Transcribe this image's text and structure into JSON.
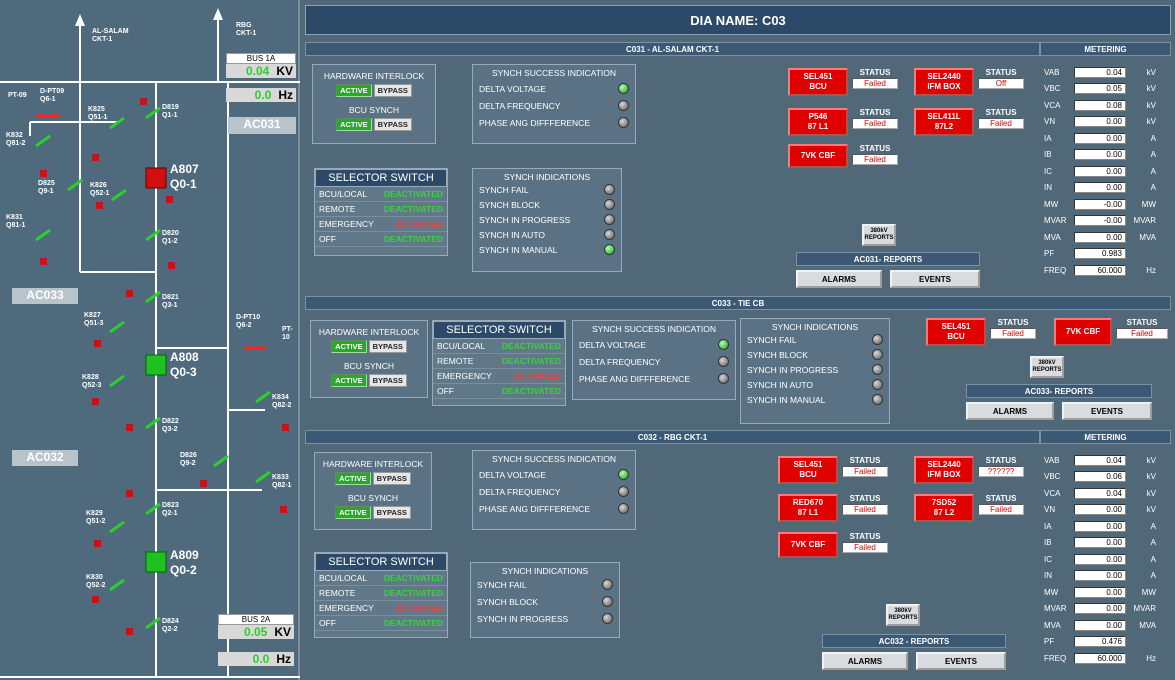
{
  "title": "DIA NAME: C03",
  "left": {
    "top_label1": "AL-SALAM",
    "top_label2": "CKT-1",
    "rbg_label1": "RBG",
    "rbg_label2": "CKT-1",
    "bus1a": "BUS 1A",
    "bus1a_kv": "0.04",
    "bus1a_kv_unit": "KV",
    "bus1a_hz": "0.0",
    "bus1a_hz_unit": "Hz",
    "ac031": "AC031",
    "ac033": "AC033",
    "ac032": "AC032",
    "bus2a": "BUS 2A",
    "bus2a_kv": "0.05",
    "bus2a_kv_unit": "KV",
    "bus2a_hz": "0.0",
    "bus2a_hz_unit": "Hz",
    "a807": "A807",
    "q01": "Q0-1",
    "a808": "A808",
    "q03": "Q0-3",
    "a809": "A809",
    "q02": "Q0-2",
    "pt09": "PT-09",
    "dpt09a": "D-PT09",
    "dpt09b": "Q6-1",
    "k825a": "K825",
    "k825b": "Q51-1",
    "d819a": "D819",
    "d819b": "Q1-1",
    "k832a": "K832",
    "k832b": "Q81-2",
    "d825a": "D825",
    "d825b": "Q9-1",
    "k826a": "K826",
    "k826b": "Q52-1",
    "k831a": "K831",
    "k831b": "Q81-1",
    "d820a": "D820",
    "d820b": "Q1-2",
    "d821a": "D821",
    "d821b": "Q3-1",
    "k827a": "K827",
    "k827b": "Q51-3",
    "dpt10a": "D-PT10",
    "dpt10b": "Q6-2",
    "pt10": "PT-10",
    "k828a": "K828",
    "k828b": "Q52-3",
    "k834a": "K834",
    "k834b": "Q82-2",
    "d822a": "D822",
    "d822b": "Q3-2",
    "d826a": "D826",
    "d826b": "Q9-2",
    "k833a": "K833",
    "k833b": "Q82-1",
    "d823a": "D823",
    "d823b": "Q2-1",
    "k829a": "K829",
    "k829b": "Q51-2",
    "k830a": "K830",
    "k830b": "Q52-2",
    "d824a": "D824",
    "d824b": "Q2-2"
  },
  "common": {
    "hw_interlock": "HARDWARE INTERLOCK",
    "bcu_synch": "BCU SYNCH",
    "active": "ACTIVE",
    "bypass": "BYPASS",
    "selector": "SELECTOR SWITCH",
    "bcu_local": "BCU/LOCAL",
    "remote": "REMOTE",
    "emergency": "EMERGENCY",
    "off": "OFF",
    "deactivated": "DEACTIVATED",
    "activated": "ACTIVATED",
    "ssi": "SYNCH SUCCESS INDICATION",
    "delta_v": "DELTA VOLTAGE",
    "delta_f": "DELTA FREQUENCY",
    "phase": "PHASE ANG DIFFFERENCE",
    "si": "SYNCH INDICATIONS",
    "s_fail": "SYNCH FAIL",
    "s_block": "SYNCH BLOCK",
    "s_prog": "SYNCH IN PROGRESS",
    "s_auto": "SYNCH IN AUTO",
    "s_manual": "SYNCH IN MANUAL",
    "status": "STATUS",
    "alarms": "ALARMS",
    "events": "EVENTS",
    "rep1": "380kV",
    "rep2": "REPORTS",
    "metering": "METERING"
  },
  "c031": {
    "title": "C031 - AL-SALAM CKT-1",
    "reports": "AC031- REPORTS",
    "relays": [
      {
        "n1": "SEL451",
        "n2": "BCU",
        "st": "Failed"
      },
      {
        "n1": "SEL2440",
        "n2": "IFM BOX",
        "st": "Off"
      },
      {
        "n1": "P546",
        "n2": "87 L1",
        "st": "Failed"
      },
      {
        "n1": "SEL411L",
        "n2": "87L2",
        "st": "Failed"
      },
      {
        "n1": "7VK CBF",
        "n2": "",
        "st": "Failed"
      }
    ],
    "meter": [
      [
        "VAB",
        "0.04",
        "kV"
      ],
      [
        "VBC",
        "0.05",
        "kV"
      ],
      [
        "VCA",
        "0.08",
        "kV"
      ],
      [
        "VN",
        "0.00",
        "kV"
      ],
      [
        "IA",
        "0.00",
        "A"
      ],
      [
        "IB",
        "0.00",
        "A"
      ],
      [
        "IC",
        "0.00",
        "A"
      ],
      [
        "IN",
        "0.00",
        "A"
      ],
      [
        "MW",
        "-0.00",
        "MW"
      ],
      [
        "MVAR",
        "-0.00",
        "MVAR"
      ],
      [
        "MVA",
        "0.00",
        "MVA"
      ],
      [
        "PF",
        "0.983",
        ""
      ],
      [
        "FREQ",
        "60.000",
        "Hz"
      ]
    ]
  },
  "c033": {
    "title": "C033 - TIE CB",
    "reports": "AC033- REPORTS",
    "relays": [
      {
        "n1": "SEL451",
        "n2": "BCU",
        "st": "Failed"
      },
      {
        "n1": "7VK CBF",
        "n2": "",
        "st": "Failed"
      }
    ]
  },
  "c032": {
    "title": "C032 - RBG CKT-1",
    "reports": "AC032 - REPORTS",
    "relays": [
      {
        "n1": "SEL451",
        "n2": "BCU",
        "st": "Failed"
      },
      {
        "n1": "SEL2440",
        "n2": "IFM BOX",
        "st": "??????"
      },
      {
        "n1": "RED670",
        "n2": "87 L1",
        "st": "Failed"
      },
      {
        "n1": "7SD52",
        "n2": "87 L2",
        "st": "Failed"
      },
      {
        "n1": "7VK CBF",
        "n2": "",
        "st": "Failed"
      }
    ],
    "meter": [
      [
        "VAB",
        "0.04",
        "kV"
      ],
      [
        "VBC",
        "0.06",
        "kV"
      ],
      [
        "VCA",
        "0.04",
        "kV"
      ],
      [
        "VN",
        "0.00",
        "kV"
      ],
      [
        "IA",
        "0.00",
        "A"
      ],
      [
        "IB",
        "0.00",
        "A"
      ],
      [
        "IC",
        "0.00",
        "A"
      ],
      [
        "IN",
        "0.00",
        "A"
      ],
      [
        "MW",
        "0.00",
        "MW"
      ],
      [
        "MVAR",
        "0.00",
        "MVAR"
      ],
      [
        "MVA",
        "0.00",
        "MVA"
      ],
      [
        "PF",
        "0.476",
        ""
      ],
      [
        "FREQ",
        "60.000",
        "Hz"
      ]
    ]
  }
}
